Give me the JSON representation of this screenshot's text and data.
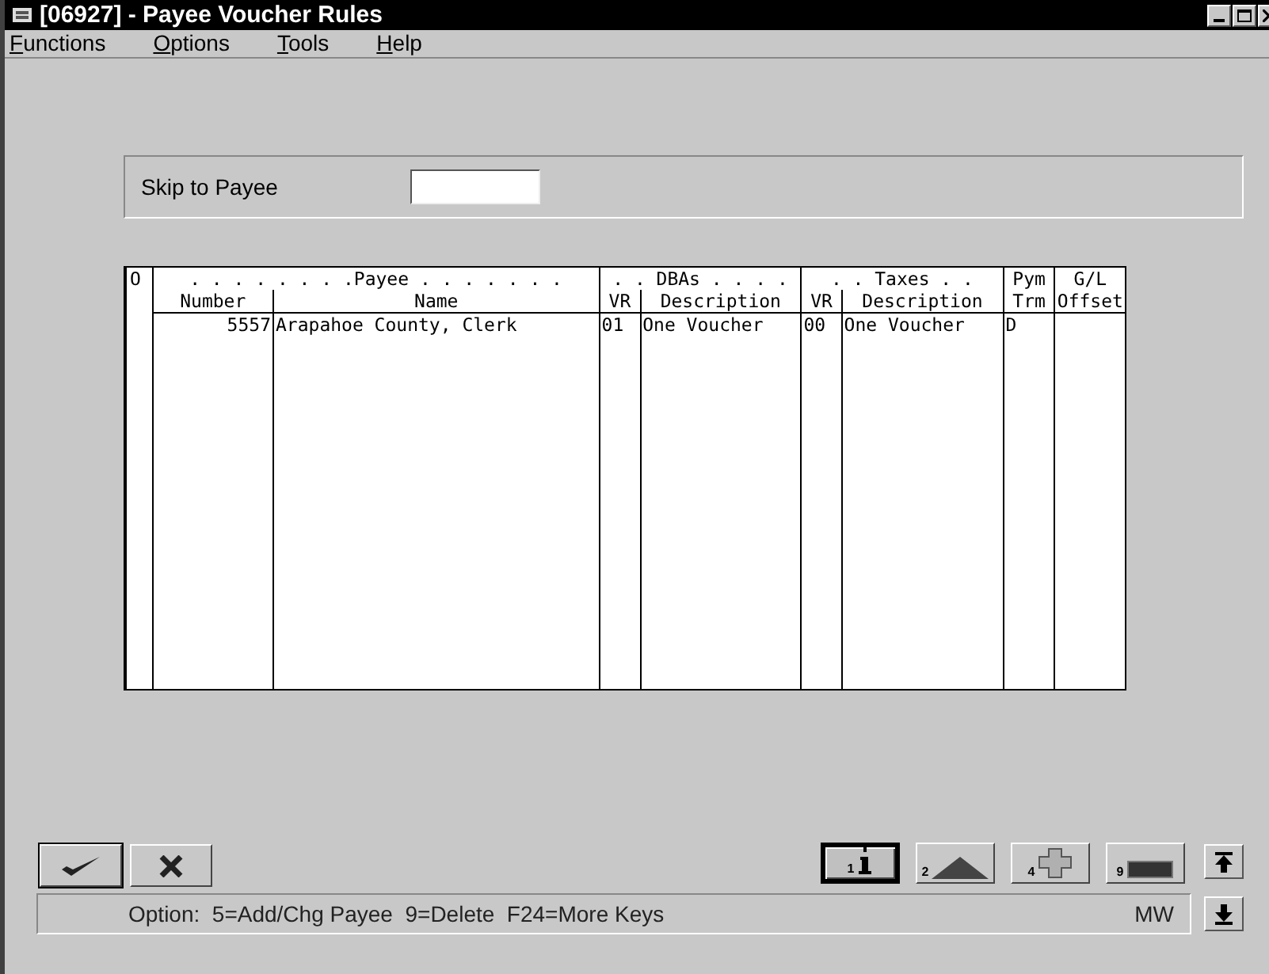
{
  "window": {
    "title": "[06927] - Payee Voucher Rules"
  },
  "menu": [
    "Functions",
    "Options",
    "Tools",
    "Help"
  ],
  "skip_to_payee": {
    "label": "Skip to Payee"
  },
  "table": {
    "group_headers": [
      ". . . . . . . .Payee . . . . . . .",
      ". . DBAs . . . .",
      ". . Taxes . .",
      "Pym",
      "G/L"
    ],
    "columns": [
      "O",
      "Number",
      "Name",
      "VR",
      "Description",
      "VR",
      "Description",
      "Trm",
      "Offset"
    ],
    "rows": [
      {
        "cells": [
          "",
          "5557",
          "Arapahoe County, Clerk",
          "01",
          "One Voucher",
          "00",
          "One Voucher",
          "D",
          ""
        ]
      }
    ]
  },
  "buttons": [
    {
      "kind": "ok"
    },
    {
      "kind": "cancel"
    }
  ],
  "exit_buttons": [
    {
      "kind": "info",
      "key": "1",
      "selected": true
    },
    {
      "kind": "triangle",
      "key": "2",
      "selected": false
    },
    {
      "kind": "plus",
      "key": "4",
      "selected": false
    },
    {
      "kind": "minus",
      "key": "9",
      "selected": false
    }
  ],
  "status_bar": {
    "text": "Option:  5=Add/Chg Payee  9=Delete  F24=More Keys",
    "mode": "MW"
  }
}
